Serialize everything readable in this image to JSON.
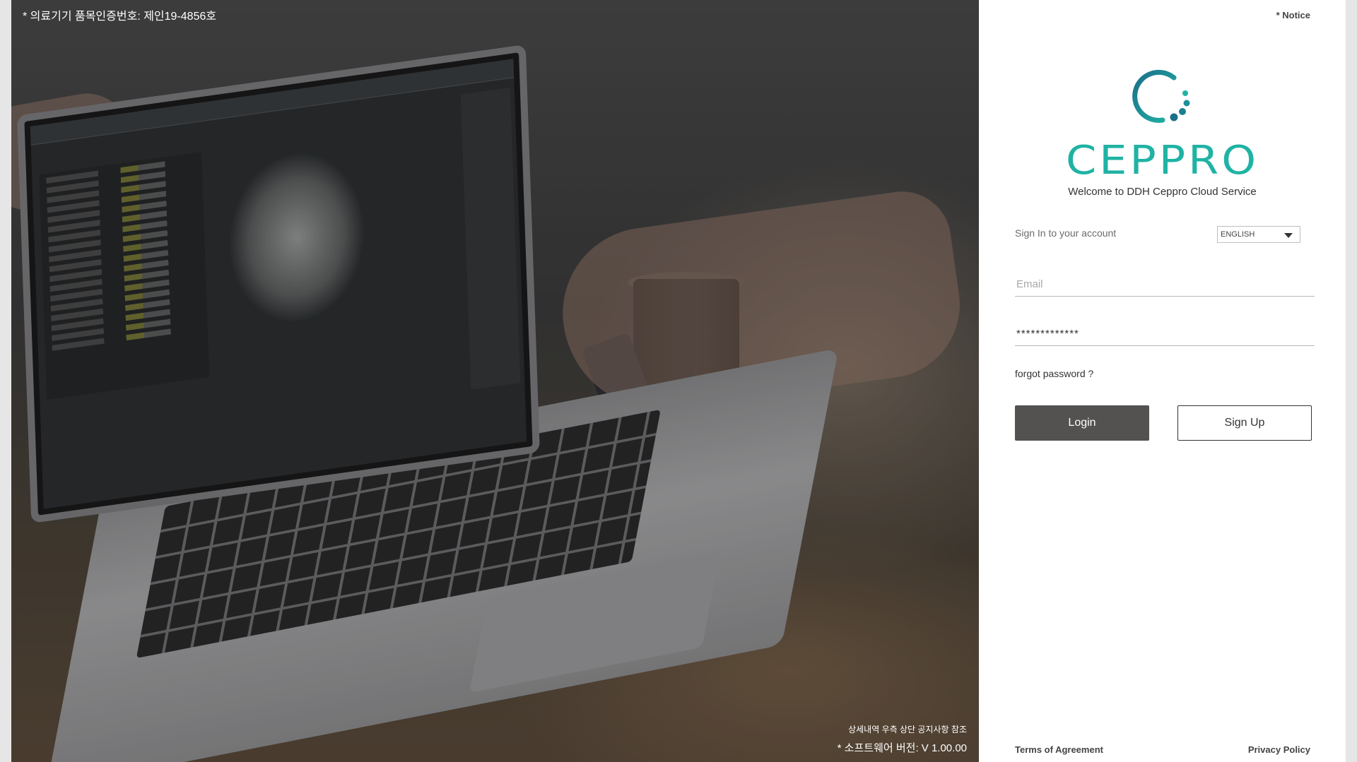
{
  "hero": {
    "cert_text": "* 의료기기 품목인증번호: 제인19-4856호",
    "detail_note": "상세내역 우측 상단 공지사항 참조",
    "software_version": "* 소프트웨어 버전: V 1.00.00"
  },
  "panel": {
    "notice_link": "* Notice",
    "brand_name": "CEPPRO",
    "welcome_text": "Welcome to DDH Ceppro Cloud Service",
    "signin_label": "Sign In to your account",
    "language": {
      "selected": "ENGLISH"
    },
    "email": {
      "placeholder": "Email",
      "value": ""
    },
    "password": {
      "value": "*************"
    },
    "forgot_password": "forgot password ?",
    "login_label": "Login",
    "signup_label": "Sign Up",
    "terms_label": "Terms of Agreement",
    "privacy_label": "Privacy Policy"
  },
  "colors": {
    "brand_teal": "#1fb3a4",
    "brand_blue": "#1c6f8a",
    "login_button": "#545151",
    "panel_background": "#ffffff"
  },
  "icons": {
    "logo": "ceppro-circle-logo-icon",
    "dropdown": "chevron-down-icon"
  }
}
